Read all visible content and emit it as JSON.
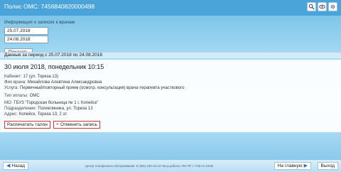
{
  "header": {
    "title": "Полис ОМС: 7456840820000498",
    "icons": [
      "search-icon",
      "eye-icon",
      "gear-icon"
    ]
  },
  "request": {
    "label": "Информация о записях к врачам",
    "date_from": "25.07.2018",
    "date_to": "24.08.2018",
    "show_button": "Показать"
  },
  "period": {
    "text": "Данные за период с 25.07.2018 по 24.08.2018"
  },
  "appointment": {
    "datetime": "30 июля 2018, понедельник 10:15",
    "cabinet_label": "Кабинет:",
    "cabinet": "17 (ул. Тореза 13)",
    "doctor_label": "Фио врача:",
    "doctor": "Михайлова Алевтина Александровна",
    "service_label": "Услуга:",
    "service": "Первичный/повторный прием (осмотр, консультация) врача-терапевта участкового",
    "payment_label": "Тип оплаты:",
    "payment": "ОМС",
    "mo_label": "МО:",
    "mo": "ГБУЗ \"Городская больница № 1 г. Копейск\"",
    "department_label": "Подразделение:",
    "department": "Поликлиника, ул. Тореза 13",
    "address_label": "Адрес:",
    "address": "Копейск, Тореза 13, 2 эт.",
    "print_button": "Распечатать талон",
    "cancel_button": "Отменить запись"
  },
  "footer": {
    "back_button": "Назад",
    "info": "Центр телефонного обслуживания: 8 (351) 240-13-13 Часы работы: ПН-ПТ с 7:00 по 19:00",
    "home_button": "На главную",
    "exit_button": "Выход"
  },
  "colors": {
    "header": "#4aa3d9",
    "accent_red": "#cf3a3a",
    "link_blue": "#2a73b8"
  }
}
